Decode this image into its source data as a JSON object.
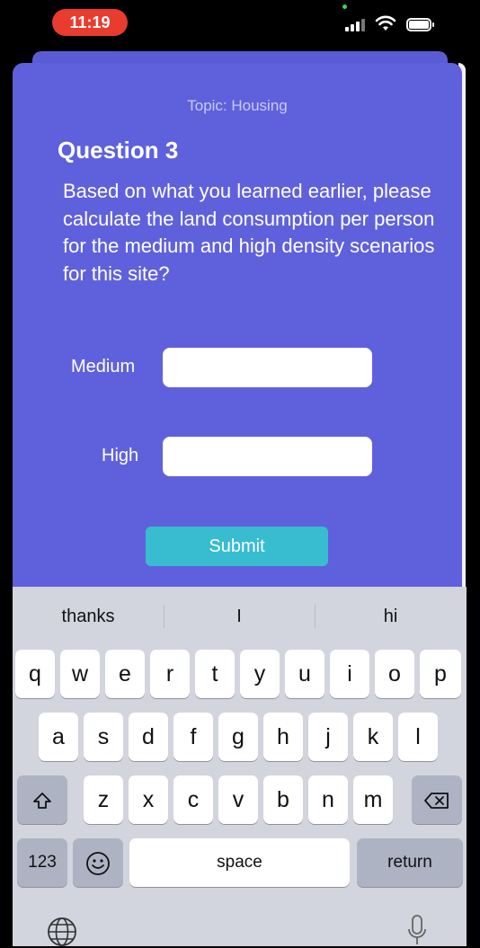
{
  "status": {
    "time": "11:19"
  },
  "card": {
    "topic": "Topic: Housing",
    "title": "Question 3",
    "question": "Based on what you learned earlier, please calculate the land consumption per person for the medium and high density scenarios for this site?",
    "fields": [
      {
        "label": "Medium",
        "value": ""
      },
      {
        "label": "High",
        "value": ""
      }
    ],
    "submit_label": "Submit"
  },
  "keyboard": {
    "suggestions": [
      "thanks",
      "I",
      "hi"
    ],
    "row1": [
      "q",
      "w",
      "e",
      "r",
      "t",
      "y",
      "u",
      "i",
      "o",
      "p"
    ],
    "row2": [
      "a",
      "s",
      "d",
      "f",
      "g",
      "h",
      "j",
      "k",
      "l"
    ],
    "row3": [
      "z",
      "x",
      "c",
      "v",
      "b",
      "n",
      "m"
    ],
    "numbers_label": "123",
    "space_label": "space",
    "return_label": "return"
  }
}
